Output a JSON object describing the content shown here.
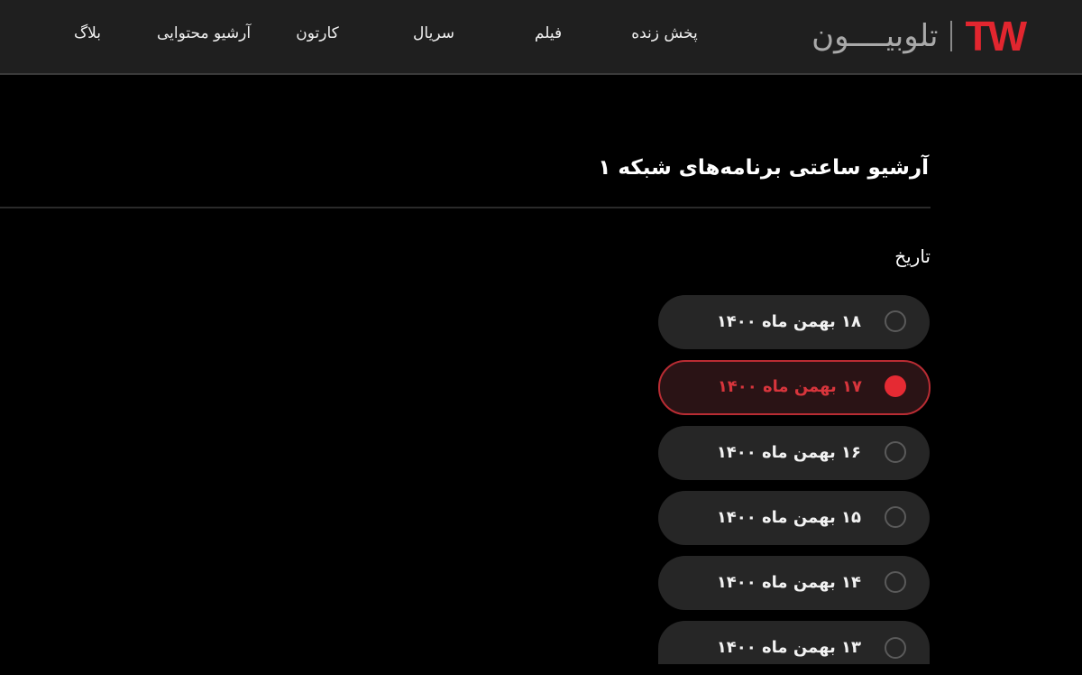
{
  "header": {
    "logo_mark": "TW",
    "logo_text": "تلوبیــــون",
    "nav": [
      {
        "label": "پخش زنده"
      },
      {
        "label": "فیلم"
      },
      {
        "label": "سریال"
      },
      {
        "label": "کارتون"
      },
      {
        "label": "آرشیو محتوایی"
      },
      {
        "label": "بلاگ"
      }
    ]
  },
  "main": {
    "title": "آرشیو ساعتی برنامه‌های شبکه ۱",
    "date_section_label": "تاریخ",
    "dates": [
      {
        "label": "۱۸ بهمن ماه ۱۴۰۰",
        "selected": false
      },
      {
        "label": "۱۷ بهمن ماه ۱۴۰۰",
        "selected": true
      },
      {
        "label": "۱۶ بهمن ماه ۱۴۰۰",
        "selected": false
      },
      {
        "label": "۱۵ بهمن ماه ۱۴۰۰",
        "selected": false
      },
      {
        "label": "۱۴ بهمن ماه ۱۴۰۰",
        "selected": false
      },
      {
        "label": "۱۳ بهمن ماه ۱۴۰۰",
        "selected": false
      }
    ]
  },
  "colors": {
    "accent": "#e52a33",
    "background": "#000000",
    "header_background": "#1f1f1f",
    "option_background": "#262626"
  }
}
